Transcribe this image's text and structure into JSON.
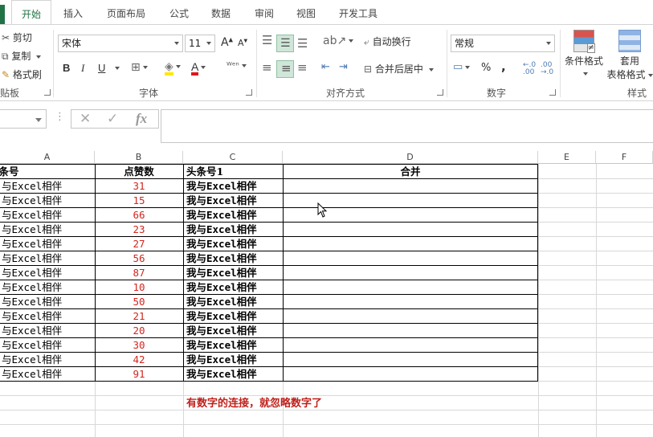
{
  "tabs": [
    {
      "label": "开始",
      "active": true
    },
    {
      "label": "插入"
    },
    {
      "label": "页面布局"
    },
    {
      "label": "公式"
    },
    {
      "label": "数据"
    },
    {
      "label": "审阅"
    },
    {
      "label": "视图"
    },
    {
      "label": "开发工具"
    }
  ],
  "clipboard": {
    "cut": "剪切",
    "copy": "复制",
    "painter": "格式刷",
    "label": "贴板"
  },
  "font": {
    "name": "宋体",
    "size": "11",
    "label": "字体",
    "bold": "B",
    "italic": "I",
    "underline": "U"
  },
  "alignment": {
    "wrap": "自动换行",
    "merge": "合并后居中",
    "label": "对齐方式"
  },
  "number": {
    "format": "常规",
    "percent": "%",
    "comma": ",",
    "label": "数字"
  },
  "styles": {
    "conditional": "条件格式",
    "table_line1": "套用",
    "table_line2": "表格格式",
    "label": "样式"
  },
  "formula": {
    "fx": "fx",
    "cancel": "✕",
    "confirm": "✓",
    "value": ""
  },
  "columns": [
    "A",
    "B",
    "C",
    "D",
    "E",
    "F"
  ],
  "table": {
    "headers": [
      "头条号",
      "点赞数",
      "头条号1",
      "合并"
    ],
    "rows": [
      [
        "与Excel相伴",
        "31",
        "我与Excel相伴",
        ""
      ],
      [
        "与Excel相伴",
        "15",
        "我与Excel相伴",
        ""
      ],
      [
        "与Excel相伴",
        "66",
        "我与Excel相伴",
        ""
      ],
      [
        "与Excel相伴",
        "23",
        "我与Excel相伴",
        ""
      ],
      [
        "与Excel相伴",
        "27",
        "我与Excel相伴",
        ""
      ],
      [
        "与Excel相伴",
        "56",
        "我与Excel相伴",
        ""
      ],
      [
        "与Excel相伴",
        "87",
        "我与Excel相伴",
        ""
      ],
      [
        "与Excel相伴",
        "10",
        "我与Excel相伴",
        ""
      ],
      [
        "与Excel相伴",
        "50",
        "我与Excel相伴",
        ""
      ],
      [
        "与Excel相伴",
        "21",
        "我与Excel相伴",
        ""
      ],
      [
        "与Excel相伴",
        "20",
        "我与Excel相伴",
        ""
      ],
      [
        "与Excel相伴",
        "30",
        "我与Excel相伴",
        ""
      ],
      [
        "与Excel相伴",
        "42",
        "我与Excel相伴",
        ""
      ],
      [
        "与Excel相伴",
        "91",
        "我与Excel相伴",
        ""
      ]
    ]
  },
  "note": "有数字的连接，就忽略数字了",
  "colors": {
    "accent": "#217346",
    "red_text": "#d4261e",
    "note_red": "#c0211b"
  }
}
